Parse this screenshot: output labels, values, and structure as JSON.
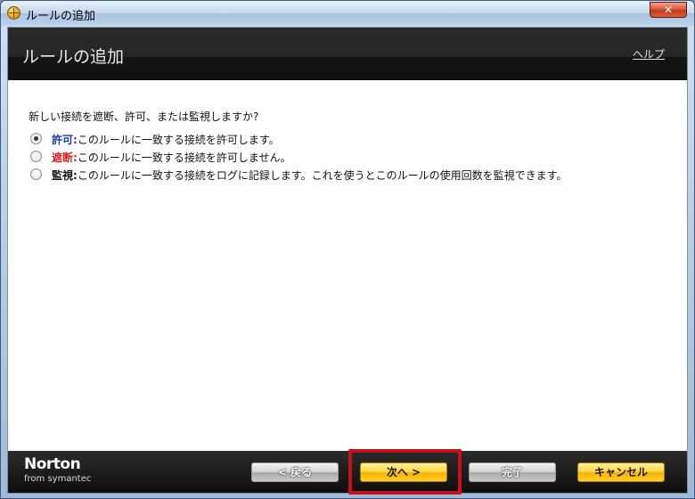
{
  "window": {
    "title": "ルールの追加",
    "close_label": "✕"
  },
  "header": {
    "title": "ルールの追加",
    "help_label": "ヘルプ"
  },
  "question": "新しい接続を遮断、許可、または監視しますか?",
  "options": [
    {
      "keyword": "許可:",
      "description": "このルールに一致する接続を許可します。",
      "checked": true
    },
    {
      "keyword": "遮断:",
      "description": "このルールに一致する接続を許可しません。",
      "checked": false
    },
    {
      "keyword": "監視:",
      "description": "このルールに一致する接続をログに記録します。これを使うとこのルールの使用回数を監視できます。",
      "checked": false
    }
  ],
  "footer": {
    "brand_name": "Norton",
    "brand_sub": "from symantec",
    "back_label": "< 戻る",
    "next_label": "次へ >",
    "finish_label": "完了",
    "cancel_label": "キャンセル"
  },
  "colors": {
    "allow_keyword": "#1a3fa3",
    "block_keyword": "#d42020",
    "highlight_border": "#c8101a"
  },
  "icons": {
    "title": "globe-icon",
    "close": "close-icon"
  }
}
